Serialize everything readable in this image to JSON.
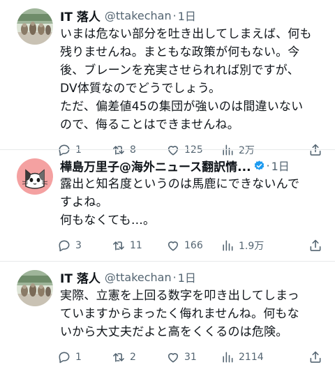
{
  "tweets": [
    {
      "name": "IT 落人",
      "handle": "@ttakechan",
      "separator": "·",
      "time": "1日",
      "text": "いまは危ない部分を吐き出してしまえば、何も\n残りませんね。まともな政策が何もない。今\n後、ブレーンを充実させられれば別ですが、\nDV体質なのでどうでしょう。\nただ、偏差値45の集団が強いのは間違いない\nので、侮ることはできませんね。",
      "replies": "1",
      "retweets": "8",
      "likes": "125",
      "views": "2万",
      "avatar": "photo-avatar"
    },
    {
      "name": "樺島万里子@海外ニュース翻訳情...",
      "handle": "",
      "separator": "·",
      "time": "1日",
      "verified": true,
      "text": "露出と知名度というのは馬鹿にできないんで\nすよね。\n何もなくても…。",
      "replies": "3",
      "retweets": "11",
      "likes": "166",
      "views": "1.9万",
      "avatar": "cat-avatar"
    },
    {
      "name": "IT 落人",
      "handle": "@ttakechan",
      "separator": "·",
      "time": "1日",
      "text": "実際、立憲を上回る数字を叩き出してしまっ\nていますからまったく侮れませんね。何もな\nいから大丈夫だよと高をくくるのは危険。",
      "replies": "1",
      "retweets": "2",
      "likes": "31",
      "views": "2114",
      "avatar": "photo-avatar"
    }
  ],
  "colors": {
    "text": "#0f1419",
    "muted": "#536471",
    "verified": "#1d9bf0",
    "cat_bg": "#f4a1a1",
    "divider": "#e7e9ea"
  },
  "icons": [
    "reply-icon",
    "retweet-icon",
    "like-icon",
    "views-icon",
    "share-icon",
    "verified-badge-icon"
  ]
}
